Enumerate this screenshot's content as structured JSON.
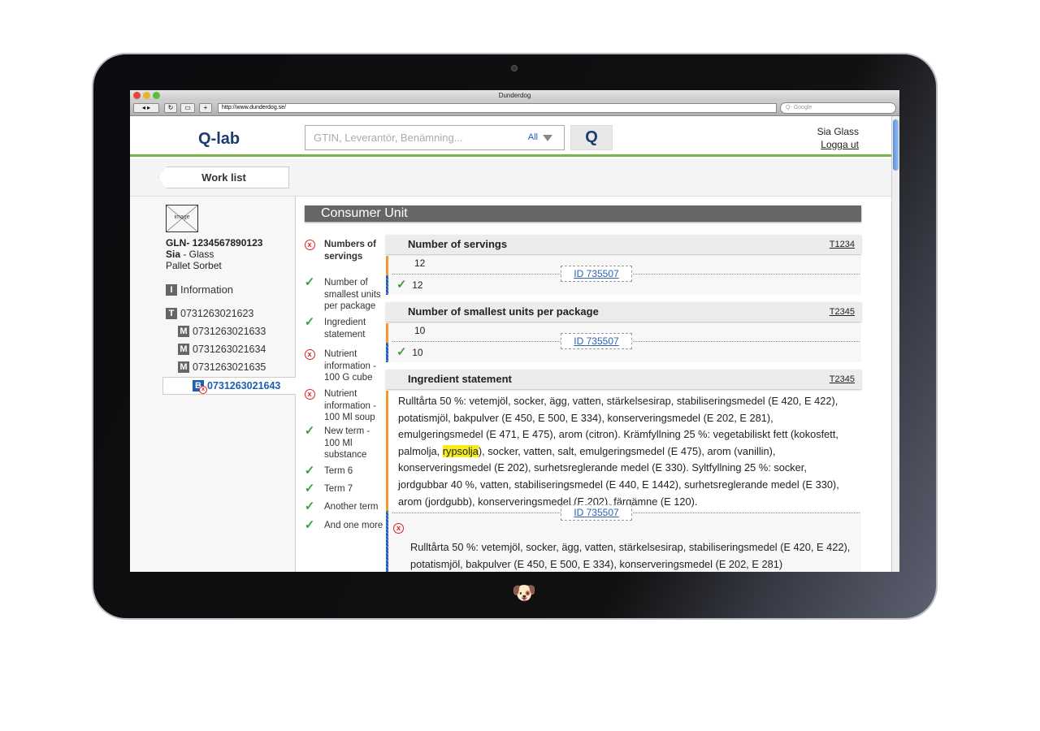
{
  "browser": {
    "title": "Dunderdog",
    "url": "http://www.dunderdog.se/",
    "search_placeholder": "Q- Google"
  },
  "header": {
    "brand": "Q-lab",
    "search_placeholder": "GTIN, Leverantör, Benämning...",
    "filter": "All",
    "search_button": "Q",
    "user": "Sia Glass",
    "logout": "Logga ut"
  },
  "worklist": {
    "label": "Work list"
  },
  "sidebar": {
    "image_label": "image",
    "gln": "GLN- 1234567890123",
    "supplier_bold": "Sia",
    "supplier_rest": " - Glass",
    "product": "Pallet Sorbet",
    "tree": [
      {
        "badge": "I",
        "label": "Information"
      },
      {
        "badge": "T",
        "label": "0731263021623"
      },
      {
        "badge": "M",
        "label": "0731263021633"
      },
      {
        "badge": "M",
        "label": "0731263021634"
      },
      {
        "badge": "M",
        "label": "0731263021635"
      },
      {
        "badge": "B",
        "label": "0731263021643",
        "selected": true,
        "status": "error"
      }
    ]
  },
  "checklist": [
    {
      "status": "error",
      "label": "Numbers of servings"
    },
    {
      "status": "ok",
      "label": "Number of smallest units per package"
    },
    {
      "status": "ok",
      "label": "Ingredient statement"
    },
    {
      "status": "error",
      "label": "Nutrient information - 100 G cube"
    },
    {
      "status": "error",
      "label": "Nutrient information - 100 Ml soup"
    },
    {
      "status": "ok",
      "label": "New term - 100 Ml substance"
    },
    {
      "status": "ok",
      "label": "Term 6"
    },
    {
      "status": "ok",
      "label": "Term 7"
    },
    {
      "status": "ok",
      "label": "Another term"
    },
    {
      "status": "ok",
      "label": "And one more"
    }
  ],
  "main": {
    "section_title": "Consumer Unit",
    "fields": [
      {
        "title": "Number of servings",
        "code": "T1234",
        "value_a": "12",
        "value_b": "12",
        "id": "ID 735507"
      },
      {
        "title": "Number of smallest units per package",
        "code": "T2345",
        "value_a": "10",
        "value_b": "10",
        "id": "ID 735507"
      },
      {
        "title": "Ingredient statement",
        "code": "T2345",
        "id": "ID 735507",
        "text_before": "Rulltårta 50 %: vetemjöl, socker, ägg, vatten, stärkelsesirap, stabiliseringsmedel (E 420, E 422), potatismjöl, bakpulver (E 450, E 500, E 334), konserveringsmedel (E 202, E 281), emulgeringsmedel (E 471, E 475), arom (citron). Krämfyllning 25 %: vegetabiliskt fett (kokosfett, palmolja, ",
        "highlight": "rypsolja",
        "text_after": "), socker, vatten, salt, emulgeringsmedel (E 475), arom (vanillin), konserveringsmedel (E 202), surhetsreglerande medel (E 330). Syltfyllning 25 %: socker, jordgubbar 40 %, vatten, stabiliseringsmedel (E 440, E 1442), surhetsreglerande medel (E 330), arom (jordgubb), konserveringsmedel (E 202), färgämne (E 120).",
        "value_b": "Rulltårta 50 %: vetemjöl, socker, ägg, vatten, stärkelsesirap, stabiliseringsmedel (E 420, E 422), potatismjöl, bakpulver (E 450, E 500, E 334), konserveringsmedel (E 202, E 281)"
      }
    ]
  },
  "colors": {
    "accent_green": "#7ab648",
    "brand_blue": "#1d3b6e",
    "link_blue": "#2a63b8",
    "error_red": "#e02020",
    "ok_green": "#3aa33a",
    "highlight": "#f5ec1a"
  }
}
